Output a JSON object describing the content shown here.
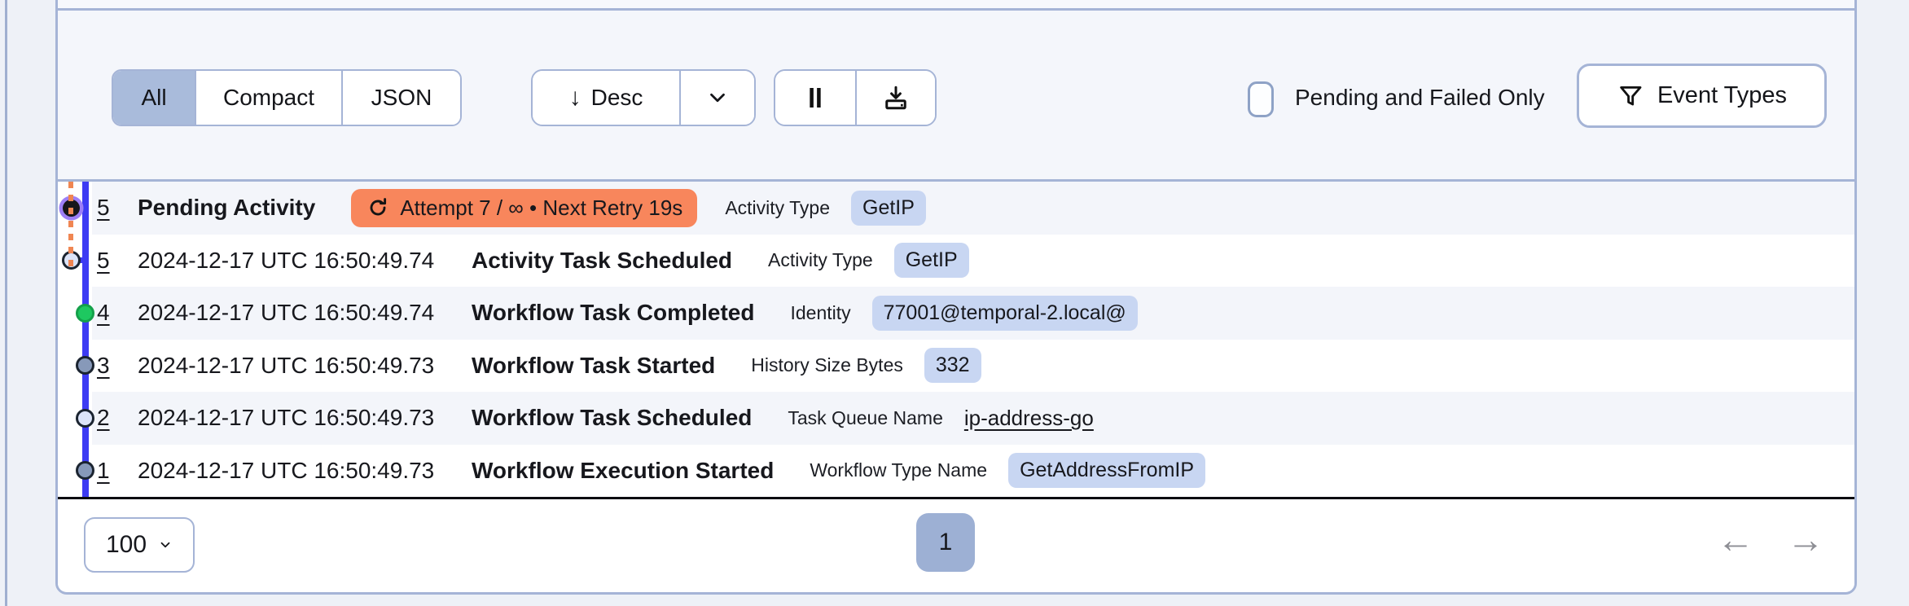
{
  "toolbar": {
    "view_tabs": [
      {
        "label": "All",
        "selected": true
      },
      {
        "label": "Compact",
        "selected": false
      },
      {
        "label": "JSON",
        "selected": false
      }
    ],
    "sort_label": "Desc",
    "pending_failed_label": "Pending and Failed Only",
    "pending_failed_checked": false,
    "event_types_label": "Event Types"
  },
  "events": [
    {
      "id": "5",
      "time": "",
      "name": "Pending Activity",
      "retry": "Attempt 7 / ∞ • Next Retry 19s",
      "attr_label": "Activity Type",
      "attr_value": "GetIP",
      "attr_kind": "badge",
      "node": "pending"
    },
    {
      "id": "5",
      "time": "2024-12-17 UTC 16:50:49.74",
      "name": "Activity Task Scheduled",
      "retry": "",
      "attr_label": "Activity Type",
      "attr_value": "GetIP",
      "attr_kind": "badge",
      "node": "scheduled-offset"
    },
    {
      "id": "4",
      "time": "2024-12-17 UTC 16:50:49.74",
      "name": "Workflow Task Completed",
      "retry": "",
      "attr_label": "Identity",
      "attr_value": "77001@temporal-2.local@",
      "attr_kind": "badge",
      "node": "completed"
    },
    {
      "id": "3",
      "time": "2024-12-17 UTC 16:50:49.73",
      "name": "Workflow Task Started",
      "retry": "",
      "attr_label": "History Size Bytes",
      "attr_value": "332",
      "attr_kind": "badge",
      "node": "started"
    },
    {
      "id": "2",
      "time": "2024-12-17 UTC 16:50:49.73",
      "name": "Workflow Task Scheduled",
      "retry": "",
      "attr_label": "Task Queue Name",
      "attr_value": "ip-address-go",
      "attr_kind": "link",
      "node": "scheduled"
    },
    {
      "id": "1",
      "time": "2024-12-17 UTC 16:50:49.73",
      "name": "Workflow Execution Started",
      "retry": "",
      "attr_label": "Workflow Type Name",
      "attr_value": "GetAddressFromIP",
      "attr_kind": "badge",
      "node": "started"
    }
  ],
  "pagination": {
    "page_size": "100",
    "current_page": "1"
  },
  "icons": {
    "sort_arrow_glyph": "↓",
    "prev_glyph": "←",
    "next_glyph": "→",
    "sort_menu": "chevron-down",
    "pause": "pause-bars",
    "download": "download-tray",
    "event_types": "funnel",
    "retry": "circular-arrow"
  },
  "colors": {
    "accent_border": "#a5b4d6",
    "selected_segment": "#a9bbdb",
    "row_alt": "#f3f5fa",
    "badge_bg": "#c8d6f2",
    "pending_badge_bg": "#f8865c",
    "timeline_blue": "#3d3bf3",
    "retry_dash_orange": "#f08652",
    "node_green": "#1ec860",
    "node_gray": "#8799b9",
    "node_light": "#dce4f8",
    "node_pending": "#17161b",
    "node_pending_ring": "#9d7ff7",
    "page_current_bg": "#9db0d4"
  }
}
